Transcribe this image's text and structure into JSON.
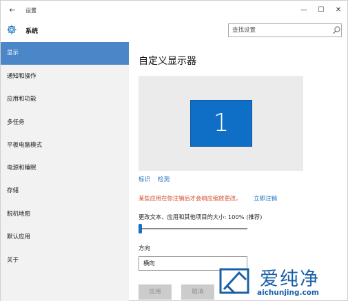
{
  "window": {
    "back_glyph": "←",
    "title": "设置",
    "minimize_glyph": "—",
    "maximize_glyph": "☐",
    "close_glyph": "✕"
  },
  "header": {
    "section_title": "系统",
    "search_placeholder": "查找设置"
  },
  "sidebar": {
    "items": [
      {
        "label": "显示",
        "active": true
      },
      {
        "label": "通知和操作"
      },
      {
        "label": "应用和功能"
      },
      {
        "label": "多任务"
      },
      {
        "label": "平板电脑模式"
      },
      {
        "label": "电源和睡眠"
      },
      {
        "label": "存储"
      },
      {
        "label": "脱机地图"
      },
      {
        "label": "默认应用"
      },
      {
        "label": "关于"
      }
    ]
  },
  "main": {
    "title": "自定义显示器",
    "monitor_number": "1",
    "link_identify": "标识",
    "link_detect": "检测",
    "warning_text": "某些应用在你注销后才会响应缩放更改。",
    "link_signout": "立即注销",
    "scale_label": "更改文本、应用和其他项目的大小: 100% (推荐)",
    "scale_value_percent": 100,
    "orientation_label": "方向",
    "orientation_value": "横向",
    "apply_label": "应用",
    "cancel_label": "取消"
  },
  "watermark": {
    "brand": "爱纯净",
    "url": "aichunjing.com"
  },
  "colors": {
    "accent": "#4a86c8",
    "monitor": "#0f6fc6",
    "link": "#1a6fc0",
    "warning": "#d24b2a",
    "sidebar_bg": "#f2f2f2"
  }
}
